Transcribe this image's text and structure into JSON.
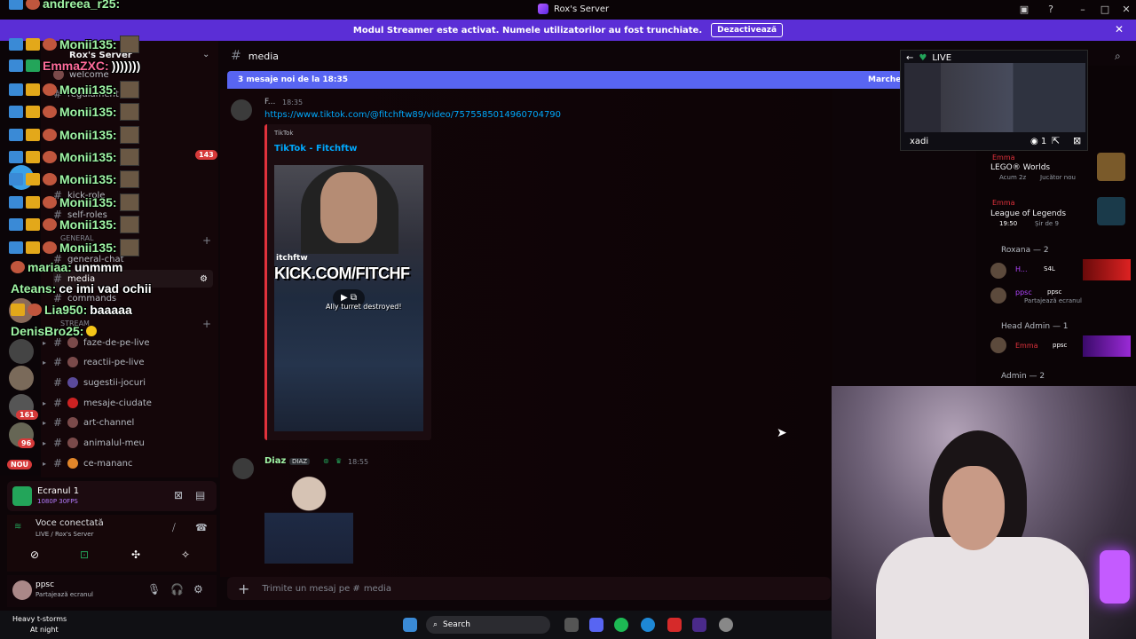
{
  "window": {
    "title": "Rox's Server"
  },
  "banner": {
    "text": "Modul Streamer este activat. Numele utilizatorilor au fost trunchiate.",
    "button": "Dezactivează"
  },
  "overlay_chat": [
    {
      "user": "andreea_r25:",
      "text": ""
    },
    {
      "user": "Monii135:",
      "text": ""
    },
    {
      "user": "EmmaZXC:",
      "text": ")))))))"
    },
    {
      "user": "Monii135:",
      "text": ""
    },
    {
      "user": "Monii135:",
      "text": ""
    },
    {
      "user": "Monii135:",
      "text": ""
    },
    {
      "user": "Monii135:",
      "text": ""
    },
    {
      "user": "Monii135:",
      "text": ""
    },
    {
      "user": "Monii135:",
      "text": ""
    },
    {
      "user": "Monii135:",
      "text": ""
    },
    {
      "user": "mariaa:",
      "text": "unmmm"
    },
    {
      "user": "Ateans:",
      "text": "ce imi vad ochii"
    },
    {
      "user": "Lia950:",
      "text": "baaaaa"
    },
    {
      "user": "DenisBro25:",
      "text": ""
    }
  ],
  "sidebar": {
    "server_name": "Rox's Server",
    "badge_count": "143",
    "channels_top": [
      "welcome",
      "regulament",
      "kick-role",
      "self-roles"
    ],
    "category_general": "GENERAL",
    "channels_general": [
      "general-chat",
      "media",
      "commands"
    ],
    "category_stream": "STREAM",
    "channels_stream": [
      "faze-de-pe-live",
      "reactii-pe-live",
      "sugestii-jocuri",
      "mesaje-ciudate",
      "art-channel",
      "animalul-meu",
      "ce-mananc"
    ],
    "rail_badges": [
      "161",
      "96",
      "NOU"
    ]
  },
  "screen_panel": {
    "title": "Ecranul 1",
    "sub": "1080P 30FPS"
  },
  "voice_panel": {
    "status": "Voce conectată",
    "sub": "LIVE / Rox's Server"
  },
  "user_panel": {
    "name": "ppsc",
    "status": "Partajează ecranul"
  },
  "chat": {
    "channel": "media",
    "new_messages": "3 mesaje noi de la 18:35",
    "mark_read": "Marchează ca citit",
    "msg1": {
      "author": "F...",
      "time": "18:35",
      "link": "https://www.tiktok.com/@fitchftw89/video/7575585014960704790",
      "embed_site": "TikTok",
      "embed_title": "TikTok - Fitchftw",
      "thumb_handle": "itchftw",
      "thumb_overlay": "KICK.COM/FITCHF",
      "thumb_caption": "Ally turret destroyed!"
    },
    "msg2": {
      "author": "Diaz",
      "tag": "DIAZ",
      "time": "18:55"
    },
    "input_placeholder": "Trimite un mesaj pe #",
    "input_channel": "media"
  },
  "stream_preview": {
    "live": "LIVE",
    "streamer": "xadi",
    "viewers": "1"
  },
  "members": {
    "activity1": {
      "name": "Emma",
      "game": "LEGO® Worlds",
      "sub": "Acum 2z",
      "tag": "Jucător nou"
    },
    "activity2": {
      "name": "Emma",
      "game": "League of Legends",
      "time": "19:50",
      "sub": "Șir de 9"
    },
    "section_roxana": "Roxana — 2",
    "roxana_members": [
      {
        "name": "H...",
        "tag": "S4L"
      },
      {
        "name": "ppsc",
        "tag": "ppsc",
        "sub": "Partajează ecranul"
      }
    ],
    "section_head_admin": "Head Admin — 1",
    "head_admin_member": {
      "name": "Emma",
      "tag": "ppsc"
    },
    "section_admin": "Admin — 2"
  },
  "taskbar": {
    "weather_title": "Heavy t-storms",
    "weather_sub": "At night",
    "search": "Search"
  },
  "colors": {
    "accent": "#5865f2",
    "banner": "#5b2ed6",
    "overlay_green": "#9ff3a4",
    "link": "#00a8fc",
    "embed_border": "#e0323c"
  }
}
